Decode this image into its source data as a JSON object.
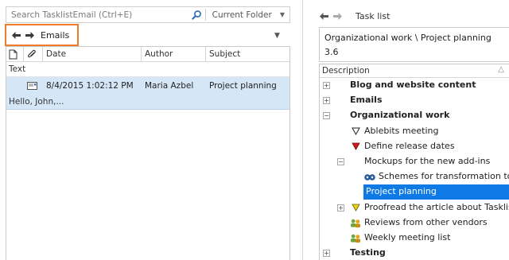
{
  "search": {
    "placeholder": "Search TasklistEmail (Ctrl+E)",
    "scope": "Current Folder"
  },
  "left_nav": {
    "title": "Emails"
  },
  "email_grid": {
    "columns": [
      "Date",
      "Author",
      "Subject"
    ],
    "group_label": "Text",
    "rows": [
      {
        "date": "8/4/2015 1:02:12 PM",
        "author": "Maria Azbel",
        "subject": "Project planning",
        "preview": "Hello, John,..."
      }
    ]
  },
  "right_nav": {
    "title": "Task list"
  },
  "task_info": {
    "path": "Organizational work \\ Project planning",
    "value": "3.6"
  },
  "tree": {
    "column": "Description",
    "items": [
      {
        "label": "Blog and website content",
        "bold": true
      },
      {
        "label": "Emails",
        "bold": true
      },
      {
        "label": "Organizational work",
        "bold": true
      },
      {
        "label": "Ablebits meeting"
      },
      {
        "label": "Define release dates"
      },
      {
        "label": "Mockups for the new add-ins"
      },
      {
        "label": "Schemes for transformation tools"
      },
      {
        "label": "Project planning"
      },
      {
        "label": "Proofread the article about Tasklist"
      },
      {
        "label": "Reviews from other vendors"
      },
      {
        "label": "Weekly meeting list"
      },
      {
        "label": "Testing",
        "bold": true
      }
    ]
  },
  "colors": {
    "accent": "#f07c2a",
    "selection": "#0f7ae5",
    "row_highlight": "#d5e7f7",
    "flag_red": "#d01818",
    "flag_yellow": "#e8d21a"
  }
}
